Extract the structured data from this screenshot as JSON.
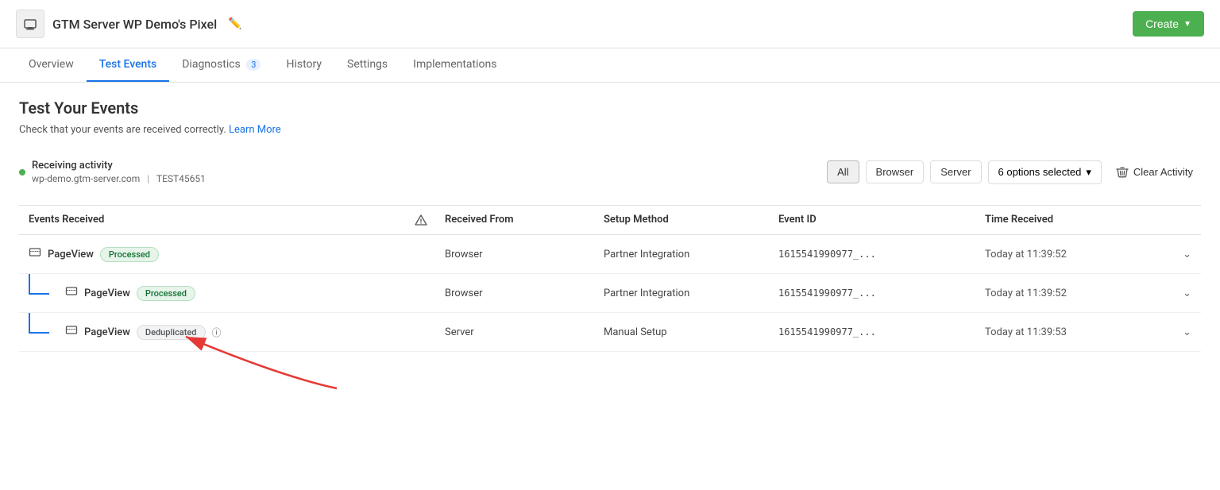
{
  "header": {
    "icon_label": "monitor-icon",
    "title": "GTM Server WP Demo's Pixel",
    "create_label": "Create"
  },
  "nav": {
    "tabs": [
      {
        "id": "overview",
        "label": "Overview",
        "active": false
      },
      {
        "id": "test-events",
        "label": "Test Events",
        "active": true
      },
      {
        "id": "diagnostics",
        "label": "Diagnostics",
        "badge": "3",
        "active": false
      },
      {
        "id": "history",
        "label": "History",
        "active": false
      },
      {
        "id": "settings",
        "label": "Settings",
        "active": false
      },
      {
        "id": "implementations",
        "label": "Implementations",
        "active": false
      }
    ]
  },
  "page": {
    "title": "Test Your Events",
    "subtitle": "Check that your events are received correctly.",
    "learn_more_label": "Learn More"
  },
  "activity": {
    "status_label": "Receiving activity",
    "domain": "wp-demo.gtm-server.com",
    "separator": "|",
    "test_id": "TEST45651"
  },
  "controls": {
    "all_label": "All",
    "browser_label": "Browser",
    "server_label": "Server",
    "options_label": "6 options selected",
    "clear_label": "Clear Activity"
  },
  "table": {
    "columns": [
      "Events Received",
      "",
      "Received From",
      "Setup Method",
      "Event ID",
      "Time Received",
      ""
    ],
    "rows": [
      {
        "level": 0,
        "event_name": "PageView",
        "badge": "Processed",
        "badge_type": "processed",
        "received_from": "Browser",
        "setup_method": "Partner Integration",
        "event_id": "1615541990977_...",
        "time": "Today at 11:39:52"
      },
      {
        "level": 1,
        "event_name": "PageView",
        "badge": "Processed",
        "badge_type": "processed",
        "received_from": "Browser",
        "setup_method": "Partner Integration",
        "event_id": "1615541990977_...",
        "time": "Today at 11:39:52"
      },
      {
        "level": 1,
        "event_name": "PageView",
        "badge": "Deduplicated",
        "badge_type": "deduplicated",
        "has_info": true,
        "received_from": "Server",
        "setup_method": "Manual Setup",
        "event_id": "1615541990977_...",
        "time": "Today at 11:39:53"
      }
    ]
  }
}
